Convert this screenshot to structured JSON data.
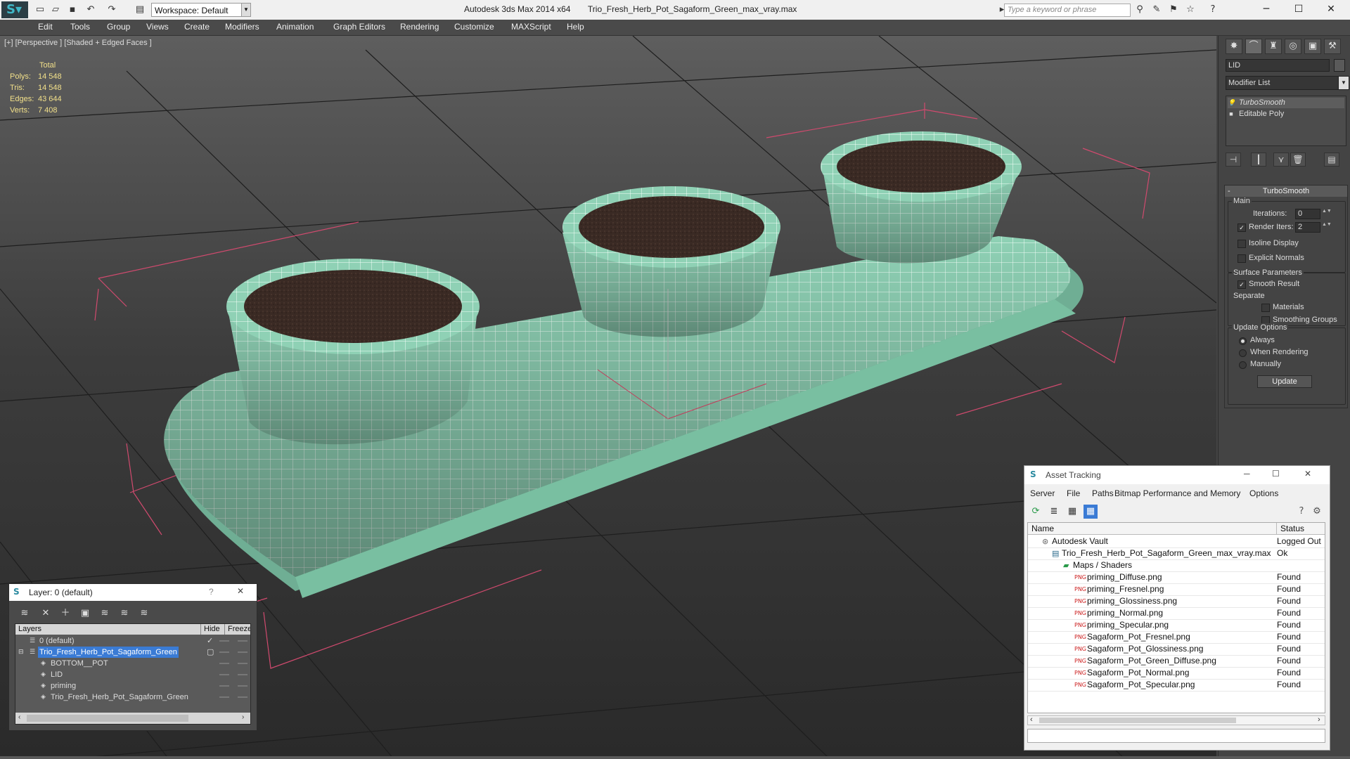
{
  "titlebar": {
    "workspace": "Workspace: Default",
    "app": "Autodesk 3ds Max  2014 x64",
    "file": "Trio_Fresh_Herb_Pot_Sagaform_Green_max_vray.max",
    "search_placeholder": "Type a keyword or phrase"
  },
  "menu": [
    "Edit",
    "Tools",
    "Group",
    "Views",
    "Create",
    "Modifiers",
    "Animation",
    "Graph Editors",
    "Rendering",
    "Customize",
    "MAXScript",
    "Help"
  ],
  "viewport": {
    "label": "[+] [Perspective ] [Shaded + Edged Faces ]",
    "stats": {
      "header": "Total",
      "rows": [
        {
          "k": "Polys:",
          "v": "14 548"
        },
        {
          "k": "Tris:",
          "v": "14 548"
        },
        {
          "k": "Edges:",
          "v": "43 644"
        },
        {
          "k": "Verts:",
          "v": "7 408"
        }
      ]
    },
    "colors": {
      "mesh": "#8fd1b5",
      "wire": "#ffffff",
      "soil": "#3a2a24",
      "bbox": "#d04a6e"
    }
  },
  "command_panel": {
    "object_name": "LID",
    "modifier_list": "Modifier List",
    "stack": [
      "TurboSmooth",
      "Editable Poly"
    ],
    "rollout": {
      "title": "TurboSmooth",
      "main": "Main",
      "iterations_label": "Iterations:",
      "iterations": "0",
      "render_iters_label": "Render Iters:",
      "render_iters": "2",
      "isoline": "Isoline Display",
      "explicit": "Explicit Normals",
      "surface": "Surface Parameters",
      "smooth": "Smooth Result",
      "separate": "Separate",
      "materials": "Materials",
      "smoothing_groups": "Smoothing Groups",
      "update_options": "Update Options",
      "always": "Always",
      "when_rendering": "When Rendering",
      "manually": "Manually",
      "update": "Update"
    }
  },
  "layer_dialog": {
    "title": "Layer: 0 (default)",
    "help": "?",
    "headers": {
      "layers": "Layers",
      "hide": "Hide",
      "freeze": "Freeze"
    },
    "rows": [
      {
        "name": "0 (default)"
      },
      {
        "name": "Trio_Fresh_Herb_Pot_Sagaform_Green"
      },
      {
        "name": "BOTTOM__POT"
      },
      {
        "name": "LID"
      },
      {
        "name": "priming"
      },
      {
        "name": "Trio_Fresh_Herb_Pot_Sagaform_Green"
      }
    ]
  },
  "asset_tracking": {
    "title": "Asset Tracking",
    "menu": [
      "Server",
      "File",
      "Paths",
      "Bitmap Performance and Memory",
      "Options"
    ],
    "headers": {
      "name": "Name",
      "status": "Status"
    },
    "rows": [
      {
        "name": "Autodesk Vault",
        "status": "Logged Out"
      },
      {
        "name": "Trio_Fresh_Herb_Pot_Sagaform_Green_max_vray.max",
        "status": "Ok"
      },
      {
        "name": "Maps / Shaders",
        "status": ""
      },
      {
        "name": "priming_Diffuse.png",
        "status": "Found"
      },
      {
        "name": "priming_Fresnel.png",
        "status": "Found"
      },
      {
        "name": "priming_Glossiness.png",
        "status": "Found"
      },
      {
        "name": "priming_Normal.png",
        "status": "Found"
      },
      {
        "name": "priming_Specular.png",
        "status": "Found"
      },
      {
        "name": "Sagaform_Pot_Fresnel.png",
        "status": "Found"
      },
      {
        "name": "Sagaform_Pot_Glossiness.png",
        "status": "Found"
      },
      {
        "name": "Sagaform_Pot_Green_Diffuse.png",
        "status": "Found"
      },
      {
        "name": "Sagaform_Pot_Normal.png",
        "status": "Found"
      },
      {
        "name": "Sagaform_Pot_Specular.png",
        "status": "Found"
      }
    ]
  }
}
